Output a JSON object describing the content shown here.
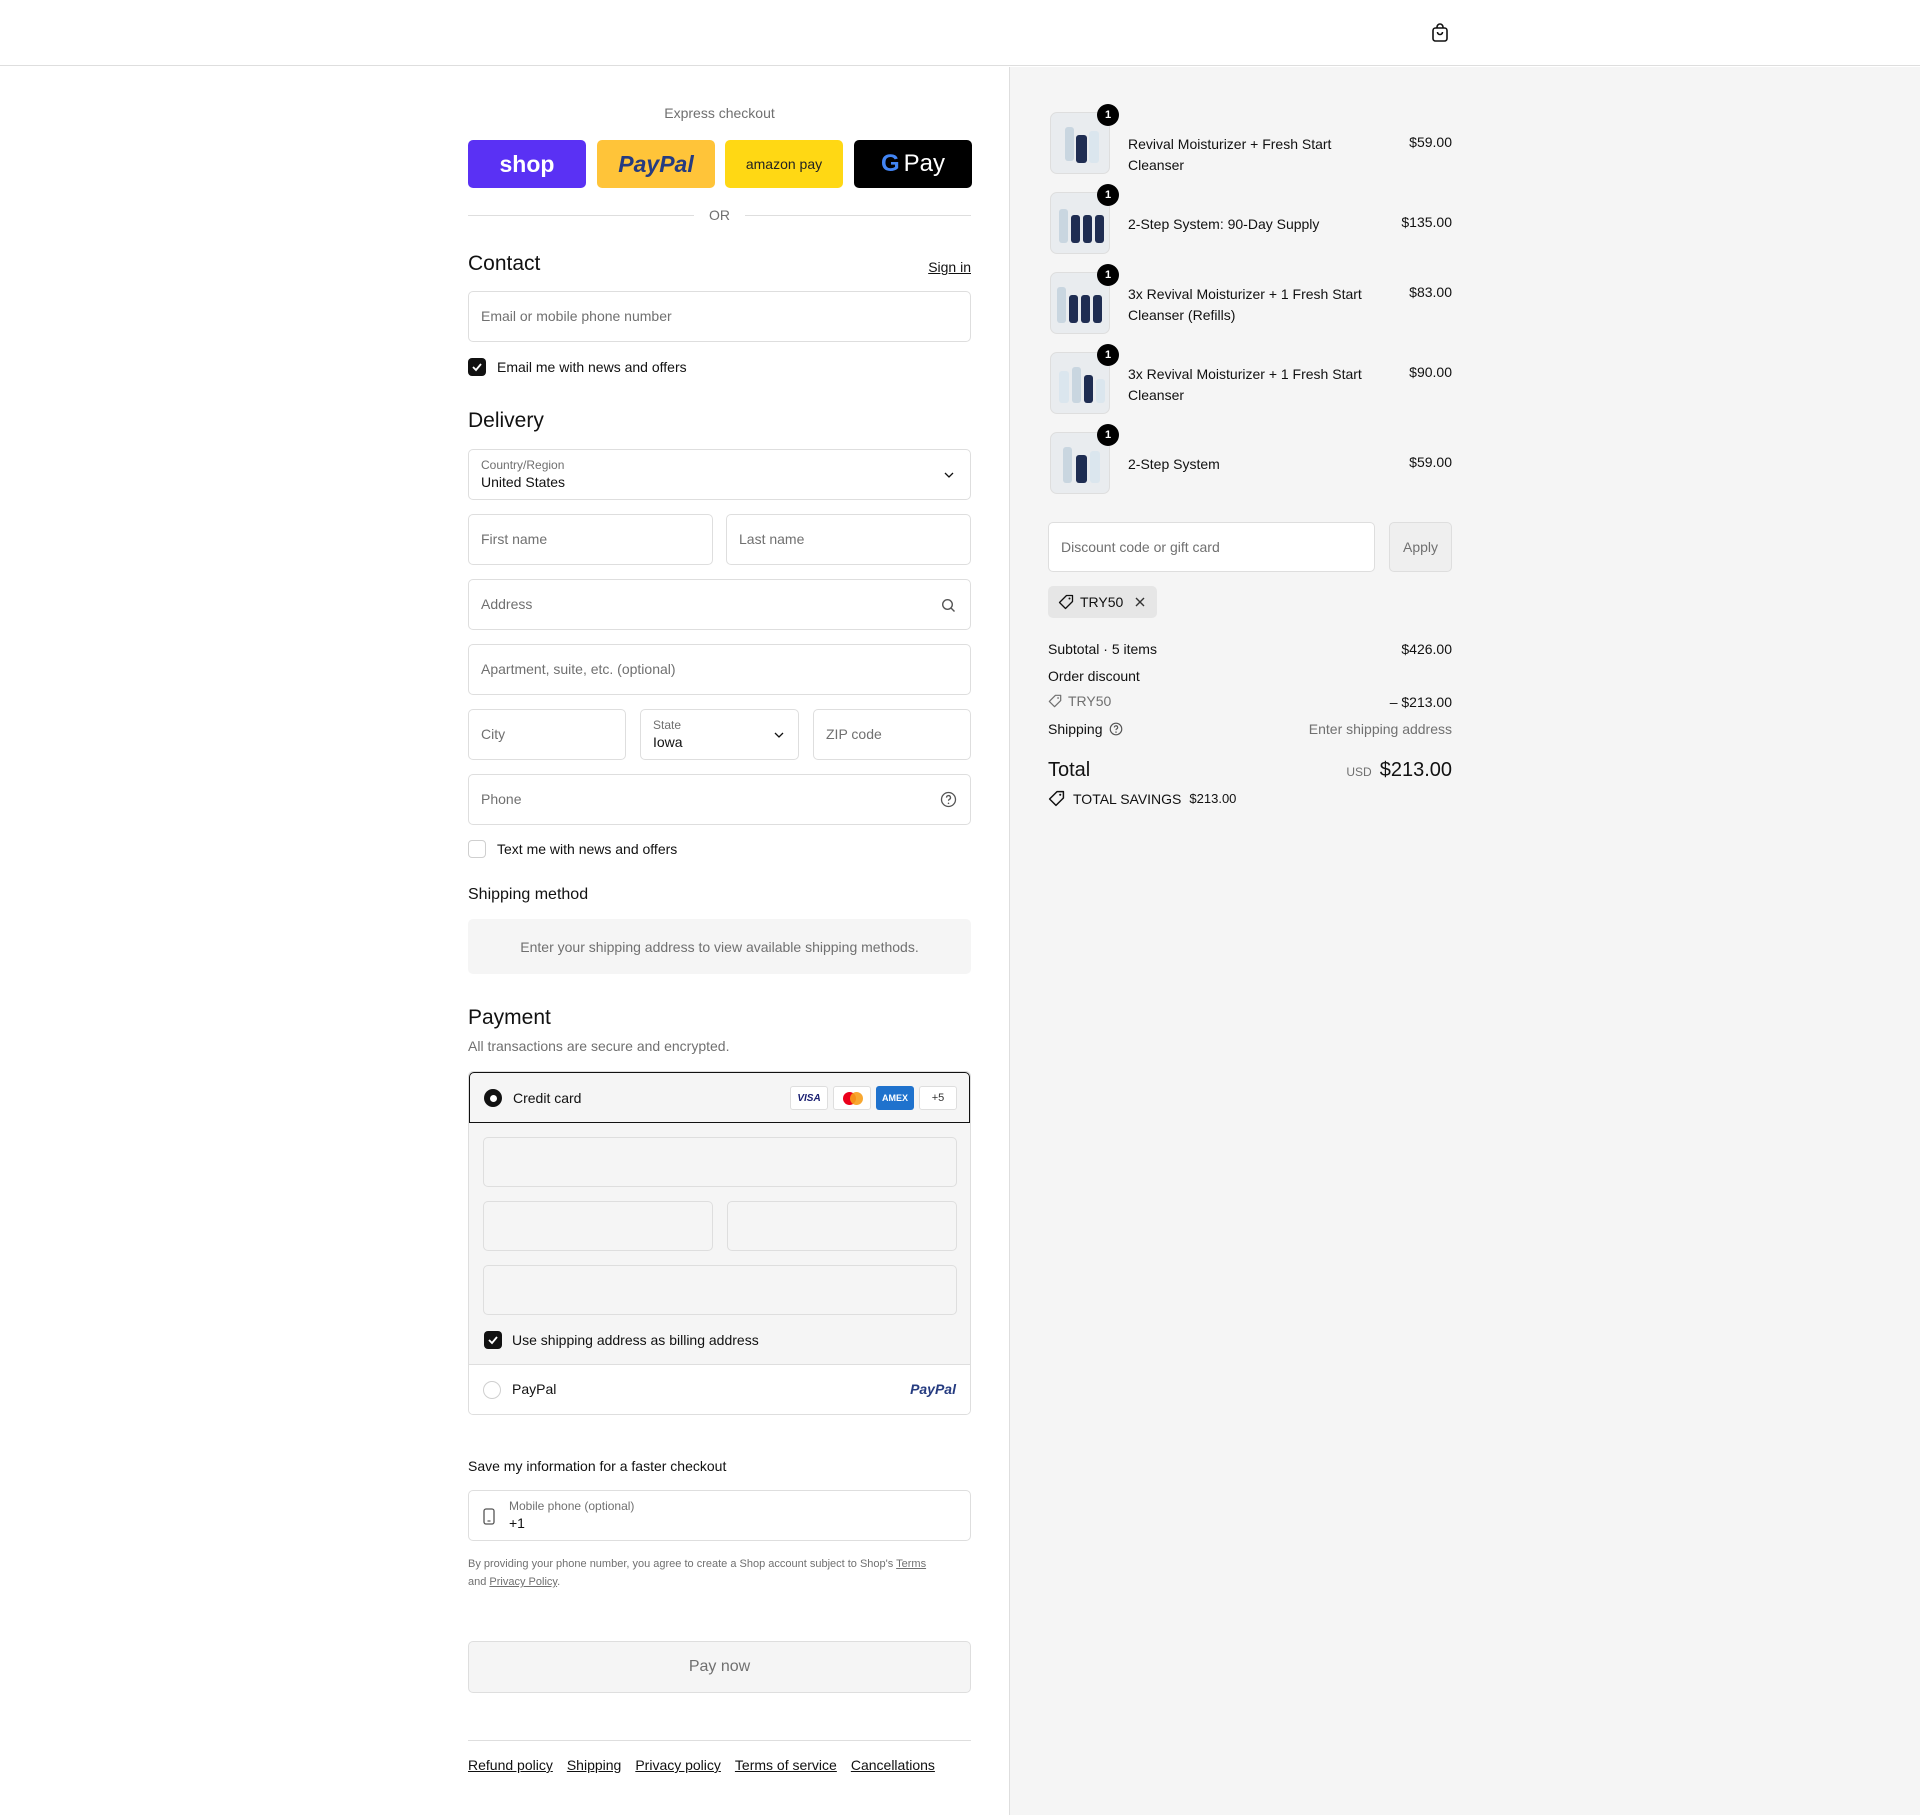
{
  "header": {
    "cart_icon": "shopping-bag-icon"
  },
  "express": {
    "title": "Express checkout",
    "shop_label": "shop",
    "paypal_label": "PayPal",
    "amazon_label": "amazon pay",
    "gpay_label": "Pay",
    "or_label": "OR"
  },
  "contact": {
    "title": "Contact",
    "signin": "Sign in",
    "email_placeholder": "Email or mobile phone number",
    "email_news": "Email me with news and offers",
    "email_news_checked": true
  },
  "delivery": {
    "title": "Delivery",
    "country_label": "Country/Region",
    "country_value": "United States",
    "first_name": "First name",
    "last_name": "Last name",
    "address": "Address",
    "apartment": "Apartment, suite, etc. (optional)",
    "city": "City",
    "state_label": "State",
    "state_value": "Iowa",
    "zip": "ZIP code",
    "phone": "Phone",
    "text_news": "Text me with news and offers",
    "text_news_checked": false
  },
  "shipping_method": {
    "title": "Shipping method",
    "message": "Enter your shipping address to view available shipping methods."
  },
  "payment": {
    "title": "Payment",
    "subtitle": "All transactions are secure and encrypted.",
    "credit_card": "Credit card",
    "cards": [
      "VISA",
      "mastercard",
      "AMEX"
    ],
    "more_cards": "+5",
    "billing_same": "Use shipping address as billing address",
    "paypal": "PayPal",
    "paypal_logo": "PayPal"
  },
  "save_info": {
    "title": "Save my information for a faster checkout",
    "mobile_label": "Mobile phone (optional)",
    "mobile_value": "+1",
    "disclaimer_pre": "By providing your phone number, you agree to create a Shop account subject to Shop's",
    "terms": "Terms",
    "and": "and",
    "privacy": "Privacy Policy",
    "period": "."
  },
  "pay_now": "Pay now",
  "footer_links": [
    "Refund policy",
    "Shipping",
    "Privacy policy",
    "Terms of service",
    "Cancellations"
  ],
  "cart": {
    "items": [
      {
        "name": "Revival Moisturizer + Fresh Start Cleanser",
        "price": "$59.00",
        "qty": "1"
      },
      {
        "name": "2-Step System: 90-Day Supply",
        "price": "$135.00",
        "qty": "1"
      },
      {
        "name": "3x Revival Moisturizer + 1 Fresh Start Cleanser (Refills)",
        "price": "$83.00",
        "qty": "1"
      },
      {
        "name": "3x Revival Moisturizer + 1 Fresh Start Cleanser",
        "price": "$90.00",
        "qty": "1"
      },
      {
        "name": "2-Step System",
        "price": "$59.00",
        "qty": "1"
      }
    ],
    "discount_placeholder": "Discount code or gift card",
    "apply": "Apply",
    "applied_code": "TRY50",
    "subtotal_label": "Subtotal · 5 items",
    "subtotal_value": "$426.00",
    "order_discount_label": "Order discount",
    "discount_code": "TRY50",
    "discount_value": "– $213.00",
    "shipping_label": "Shipping",
    "shipping_value": "Enter shipping address",
    "total_label": "Total",
    "currency": "USD",
    "total_value": "$213.00",
    "savings_label": "TOTAL SAVINGS",
    "savings_value": "$213.00"
  }
}
